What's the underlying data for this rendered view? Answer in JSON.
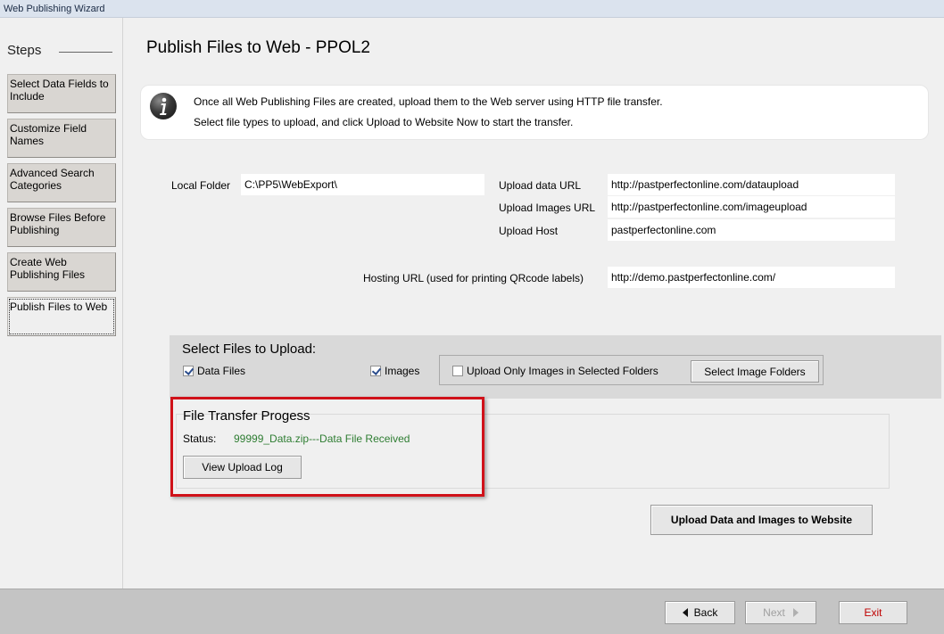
{
  "window": {
    "title": "Web Publishing Wizard"
  },
  "sidebar": {
    "header": "Steps",
    "steps": [
      {
        "label": "Select Data Fields to Include"
      },
      {
        "label": "Customize Field Names"
      },
      {
        "label": "Advanced Search Categories"
      },
      {
        "label": "Browse Files Before Publishing"
      },
      {
        "label": "Create Web Publishing Files"
      },
      {
        "label": "Publish Files to Web",
        "active": true
      }
    ]
  },
  "main": {
    "title": "Publish Files to Web - PPOL2",
    "info": {
      "icon": "info-icon",
      "line1": "Once all Web Publishing Files are created, upload them to the Web server using HTTP file transfer.",
      "line2": "Select file types to upload, and click Upload to Website Now to start the transfer."
    },
    "settings": {
      "local_folder_label": "Local Folder",
      "local_folder_value": "C:\\PP5\\WebExport\\",
      "upload_data_url_label": "Upload data URL",
      "upload_data_url_value": "http://pastperfectonline.com/dataupload",
      "upload_images_url_label": "Upload Images URL",
      "upload_images_url_value": "http://pastperfectonline.com/imageupload",
      "upload_host_label": "Upload Host",
      "upload_host_value": "pastperfectonline.com",
      "hosting_url_label": "Hosting URL (used for printing QRcode labels)",
      "hosting_url_value": "http://demo.pastperfectonline.com/"
    },
    "upload": {
      "title": "Select Files to Upload:",
      "data_files_label": "Data Files",
      "data_files_checked": true,
      "images_label": "Images",
      "images_checked": true,
      "only_selected_label": "Upload Only Images in Selected Folders",
      "only_selected_checked": false,
      "select_folders_button": "Select Image Folders"
    },
    "progress": {
      "title": "File Transfer Progess",
      "status_label": "Status:",
      "status_value": "99999_Data.zip---Data File Received",
      "view_log_button": "View Upload Log"
    },
    "upload_button": "Upload Data and Images to Website"
  },
  "footer": {
    "back_button": "Back",
    "next_button": "Next",
    "exit_button": "Exit"
  },
  "colors": {
    "highlight_frame": "#d0121a",
    "status_text": "#2e7d32",
    "exit_text": "#c00000"
  }
}
